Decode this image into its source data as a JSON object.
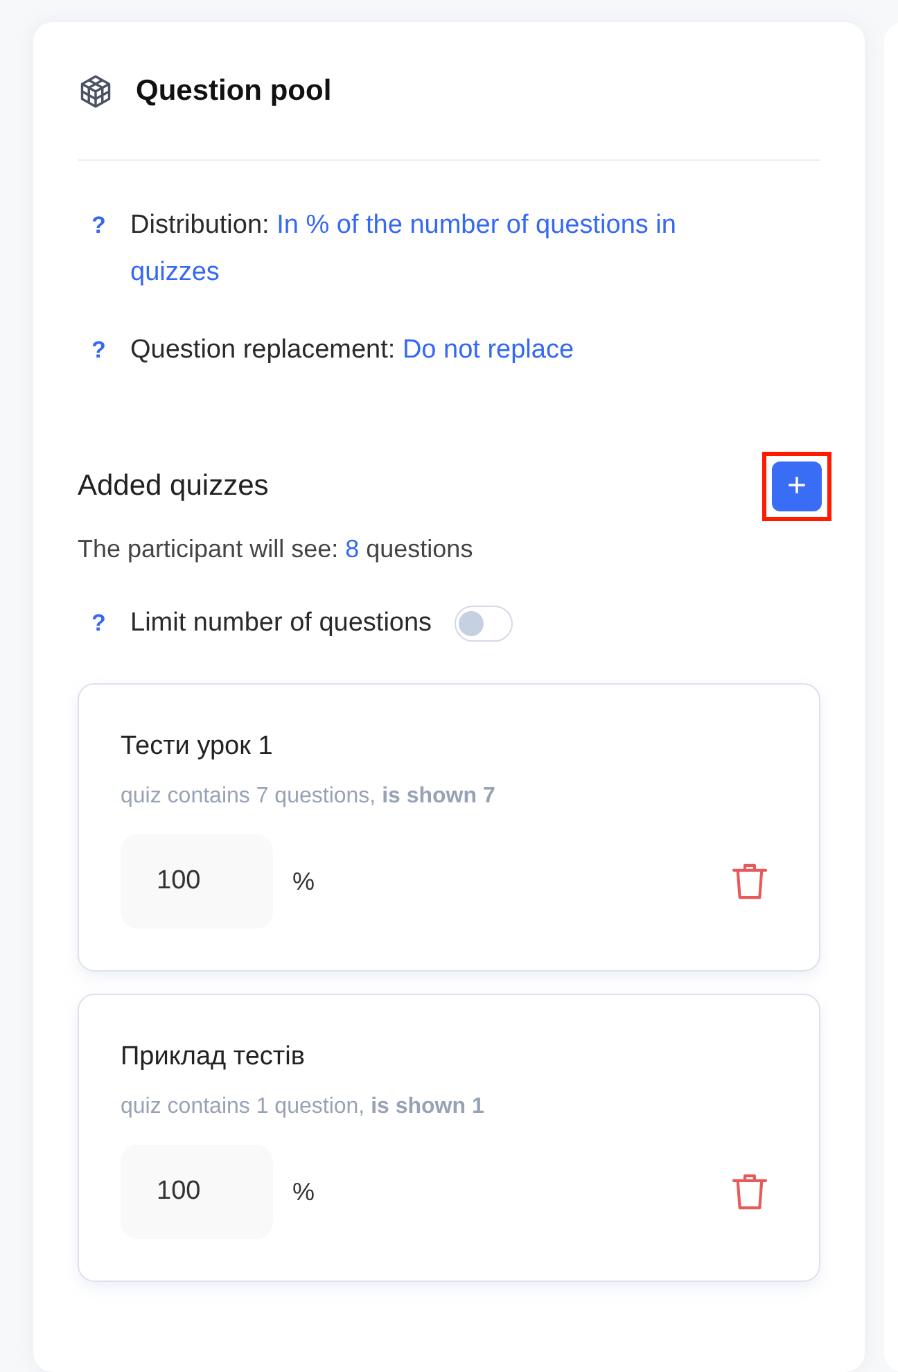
{
  "panel": {
    "title": "Question pool"
  },
  "settings": [
    {
      "label": "Distribution:",
      "value": "In % of the number of questions in quizzes",
      "help": "?"
    },
    {
      "label": "Question replacement:",
      "value": "Do not replace",
      "help": "?"
    }
  ],
  "quizzes_section": {
    "title": "Added quizzes",
    "add_button": {
      "label": "+",
      "highlighted": true
    },
    "summary_prefix": "The participant will see:",
    "summary_count": "8",
    "summary_suffix": "questions",
    "limit": {
      "help": "?",
      "label": "Limit number of questions",
      "on": false
    }
  },
  "quizzes": [
    {
      "name": "Тести урок 1",
      "info": "quiz contains 7 questions, **is shown 7**",
      "value": "100",
      "unit": "%"
    },
    {
      "name": "Приклад тестів",
      "info": "quiz contains 1 question, **is shown 1**",
      "value": "100",
      "unit": "%"
    }
  ]
}
